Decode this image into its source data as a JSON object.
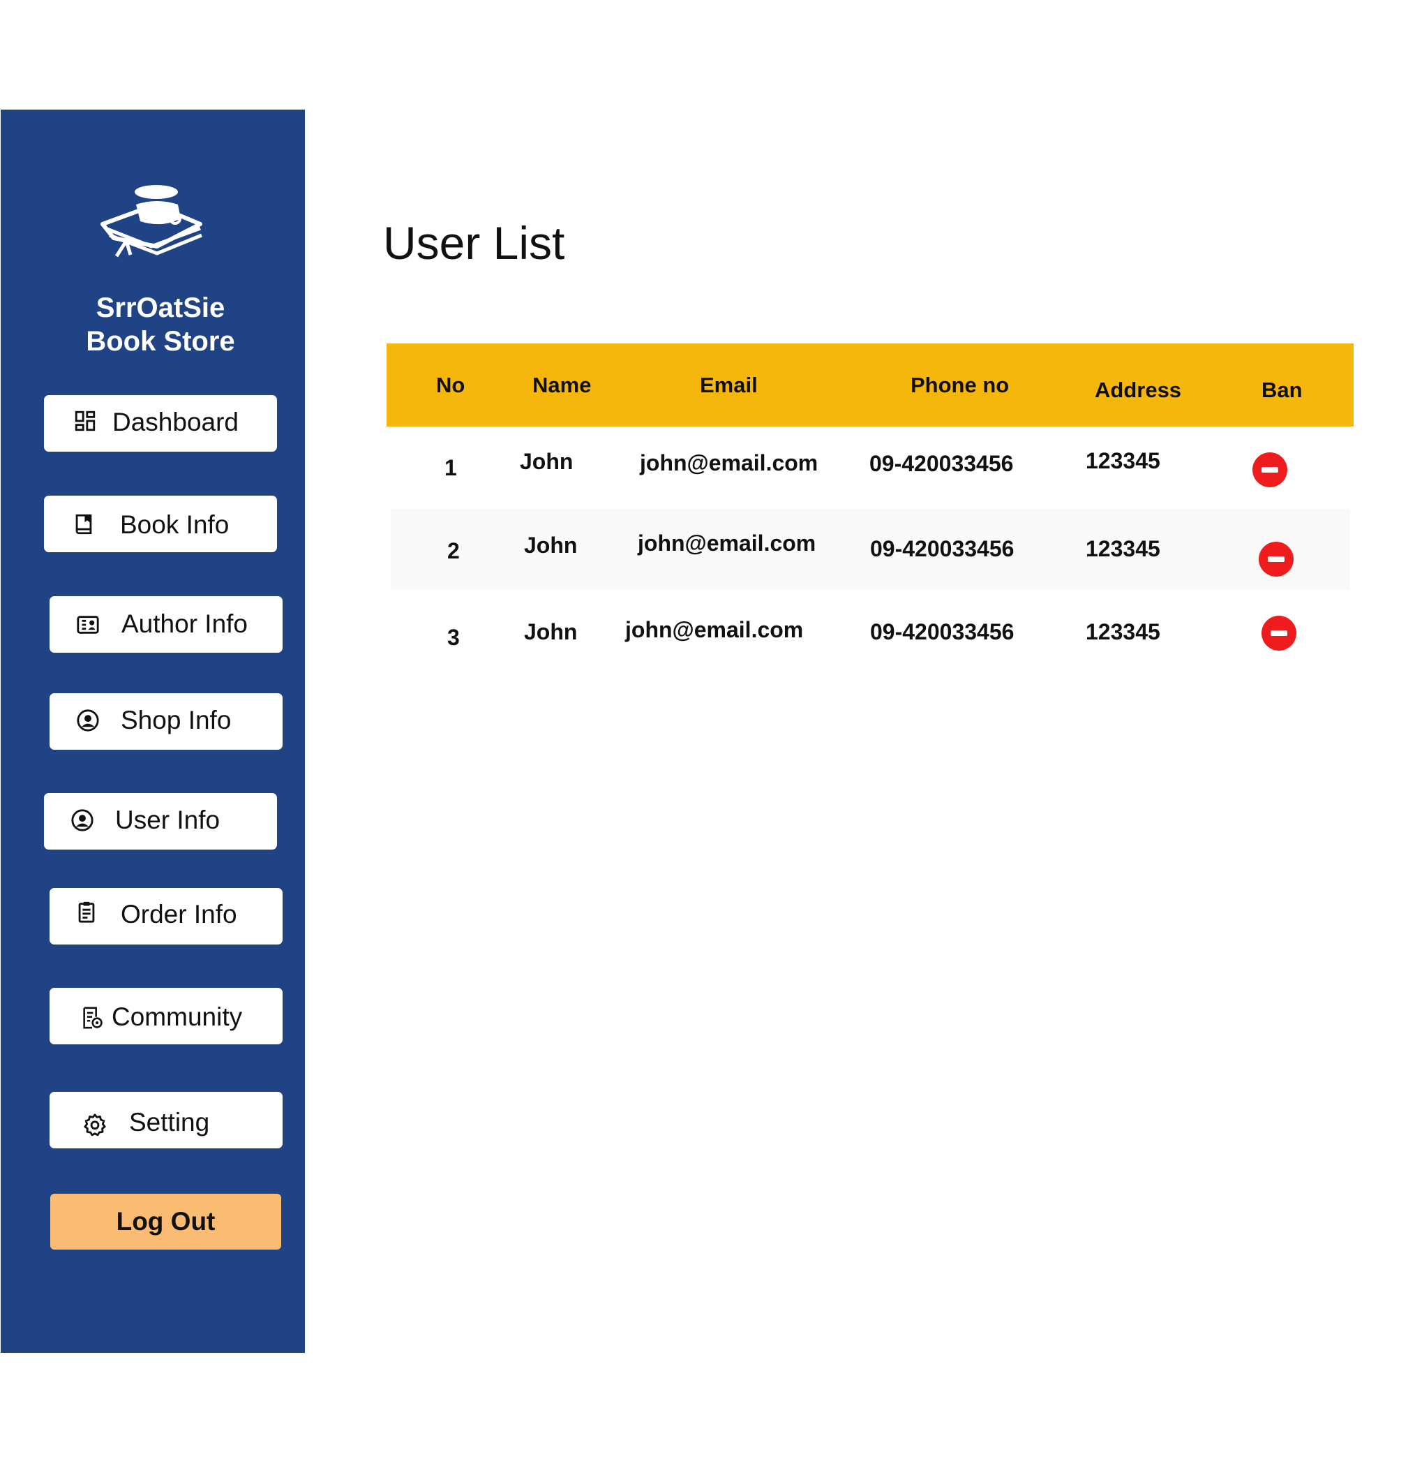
{
  "sidebar": {
    "brand_line1": "SrrOatSie",
    "brand_line2": "Book Store",
    "items": [
      {
        "label": "Dashboard",
        "icon": "dashboard-icon"
      },
      {
        "label": "Book Info",
        "icon": "book-icon"
      },
      {
        "label": "Author Info",
        "icon": "author-card-icon"
      },
      {
        "label": "Shop Info",
        "icon": "user-circle-icon"
      },
      {
        "label": "User Info",
        "icon": "user-circle-icon"
      },
      {
        "label": "Order Info",
        "icon": "clipboard-icon"
      },
      {
        "label": "Community",
        "icon": "community-doc-icon"
      },
      {
        "label": "Setting",
        "icon": "gear-icon"
      }
    ],
    "logout_label": "Log Out"
  },
  "main": {
    "title": "User List",
    "table": {
      "columns": [
        "No",
        "Name",
        "Email",
        "Phone no",
        "Address",
        "Ban"
      ],
      "rows": [
        [
          "1",
          "John",
          "john@email.com",
          "09-420033456",
          "123345"
        ],
        [
          "2",
          "John",
          "john@email.com",
          "09-420033456",
          "123345"
        ],
        [
          "3",
          "John",
          "john@email.com",
          "09-420033456",
          "123345"
        ]
      ]
    }
  },
  "colors": {
    "sidebar": "#204385",
    "header": "#f6b70c",
    "logout": "#f9bc72",
    "ban": "#ee1c1c"
  }
}
